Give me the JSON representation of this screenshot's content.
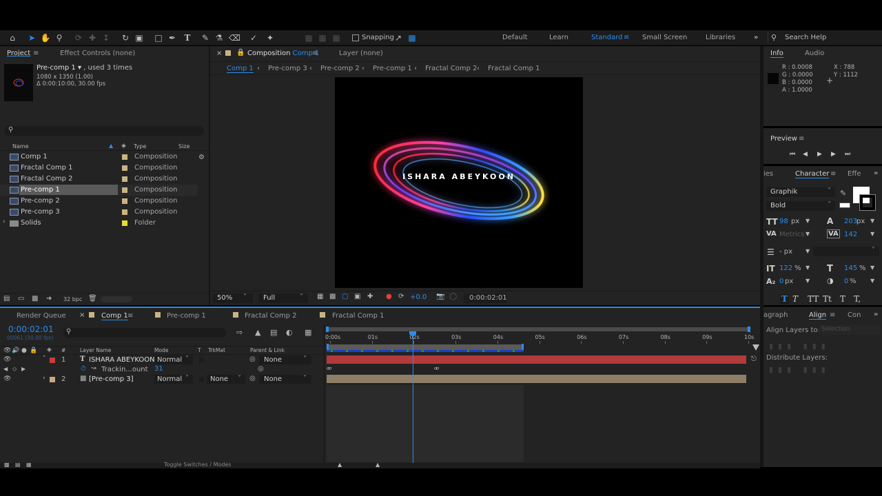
{
  "toolbar": {
    "snapping_label": "Snapping",
    "workspaces": [
      "Default",
      "Learn",
      "Standard",
      "Small Screen",
      "Libraries"
    ],
    "active_workspace": "Standard",
    "search_placeholder": "Search Help"
  },
  "project_panel": {
    "tab_project": "Project",
    "tab_effect_controls": "Effect Controls (none)",
    "selected_name": "Pre-comp 1",
    "used_times": ", used 3 times",
    "dims": "1080 x 1350 (1.00)",
    "duration": "Δ 0:00:10:00, 30.00 fps",
    "columns": {
      "name": "Name",
      "type": "Type",
      "size": "Size"
    },
    "items": [
      {
        "name": "Comp 1",
        "type": "Composition",
        "color": "#c8b482"
      },
      {
        "name": "Fractal Comp 1",
        "type": "Composition",
        "color": "#c8b482"
      },
      {
        "name": "Fractal Comp 2",
        "type": "Composition",
        "color": "#c8b482"
      },
      {
        "name": "Pre-comp 1",
        "type": "Composition",
        "color": "#c8b482"
      },
      {
        "name": "Pre-comp 2",
        "type": "Composition",
        "color": "#c8b482"
      },
      {
        "name": "Pre-comp 3",
        "type": "Composition",
        "color": "#c8b482"
      },
      {
        "name": "Solids",
        "type": "Folder",
        "color": "#e6dc32"
      }
    ],
    "bpc": "32 bpc"
  },
  "comp_viewer": {
    "tab_label": "Composition",
    "tab_comp": "Comp 1",
    "layer_tab": "Layer (none)",
    "breadcrumbs": [
      "Comp 1",
      "Pre-comp 3",
      "Pre-comp 2",
      "Pre-comp 1",
      "Fractal Comp 2",
      "Fractal Comp 1"
    ],
    "canvas_text": "ISHARA ABEYKOON",
    "zoom": "50%",
    "resolution": "Full",
    "exposure": "+0.0",
    "timecode": "0:00:02:01"
  },
  "info_panel": {
    "tab_info": "Info",
    "tab_audio": "Audio",
    "r": "R : 0.0008",
    "g": "G : 0.0000",
    "b": "B : 0.0000",
    "a": "A : 1.0000",
    "x": "X : 788",
    "y": "Y : 1112"
  },
  "preview_panel": {
    "title": "Preview"
  },
  "character_panel": {
    "tab_prev": "ies",
    "tab_character": "Character",
    "tab_next": "Effe",
    "font": "Graphik",
    "style": "Bold",
    "size": "98",
    "size_unit": "px",
    "leading": "203",
    "leading_unit": "px",
    "kerning": "Metrics",
    "tracking": "142",
    "stroke_unit": "- px",
    "vscale": "122",
    "hscale": "145",
    "baseline": "0",
    "baseline_unit": "px",
    "tsume": "0",
    "pct": "%",
    "type_buttons": [
      "T",
      "T",
      "TT",
      "Tt",
      "T",
      "T,"
    ]
  },
  "align_panel": {
    "tab_prev": "agraph",
    "tab_align": "Align",
    "tab_next": "Con",
    "align_to_label": "Align Layers to:",
    "align_to_value": "Selection",
    "distribute_label": "Distribute Layers:"
  },
  "timeline": {
    "tabs": [
      "Render Queue",
      "Comp 1",
      "Pre-comp 1",
      "Fractal Comp 2",
      "Fractal Comp 1"
    ],
    "timecode": "0:00:02:01",
    "frames": "00061 (30.00 fps)",
    "columns": {
      "layer_name": "Layer Name",
      "mode": "Mode",
      "t": "T",
      "trkmat": "TrkMat",
      "parent": "Parent & Link",
      "num": "#"
    },
    "ruler": [
      "0:00s",
      "01s",
      "02s",
      "03s",
      "04s",
      "05s",
      "06s",
      "07s",
      "08s",
      "09s",
      "10s"
    ],
    "layers": [
      {
        "num": "1",
        "name": "ISHARA ABEYKOON",
        "mode": "Normal",
        "trkmat": "",
        "parent": "None",
        "color": "#c83c3c"
      },
      {
        "num": "2",
        "name": "[Pre-comp 3]",
        "mode": "Normal",
        "trkmat": "None",
        "parent": "None",
        "color": "#c8a882"
      }
    ],
    "property": {
      "name": "Trackin...ount",
      "value": "31"
    },
    "footer": "Toggle Switches / Modes"
  }
}
